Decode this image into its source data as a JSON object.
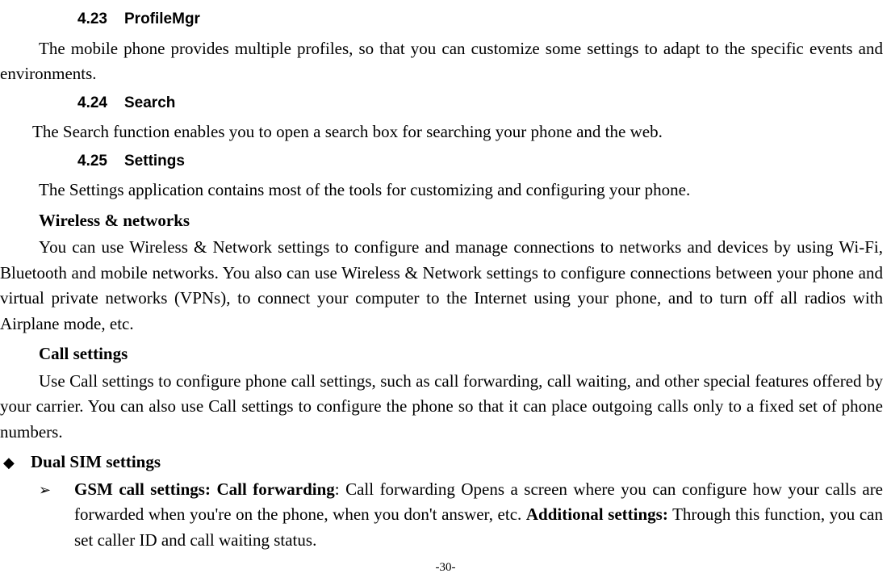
{
  "sections": {
    "s423": {
      "num": "4.23",
      "title": "ProfileMgr"
    },
    "s424": {
      "num": "4.24",
      "title": "Search"
    },
    "s425": {
      "num": "4.25",
      "title": "Settings"
    }
  },
  "paragraphs": {
    "profileMgr": "The mobile phone provides multiple profiles, so that you can customize some settings to adapt to the specific events and environments.",
    "search": "The Search function enables you to open a search box for searching your phone and the web.",
    "settingsIntro": "The Settings application contains most of the tools for customizing and configuring your phone.",
    "wirelessTitle": "Wireless & networks",
    "wirelessBody": "You can use Wireless & Network settings to configure and manage connections to networks and devices by using Wi-Fi, Bluetooth and mobile networks. You also can use Wireless & Network settings to configure connections between your phone and virtual private networks (VPNs), to connect your computer to the Internet using your phone, and to turn off all radios with Airplane mode, etc.",
    "callTitle": "Call settings",
    "callBody": "Use Call settings to configure phone call settings, such as call forwarding, call waiting, and other special features offered by your carrier. You can also use Call settings to configure the phone so that it can place outgoing calls only to a fixed set of phone numbers.",
    "dualSim": "Dual SIM settings",
    "gsmBold1": "GSM call settings: Call forwarding",
    "gsmText1": ": Call forwarding Opens a screen where you can configure how your calls are forwarded when you're on the phone, when you don't answer, etc. ",
    "gsmBold2": "Additional settings:",
    "gsmText2": " Through this function, you can set caller ID and call waiting status."
  },
  "symbols": {
    "diamond": "◆",
    "arrow": "➢"
  },
  "pageNumber": "-30-"
}
